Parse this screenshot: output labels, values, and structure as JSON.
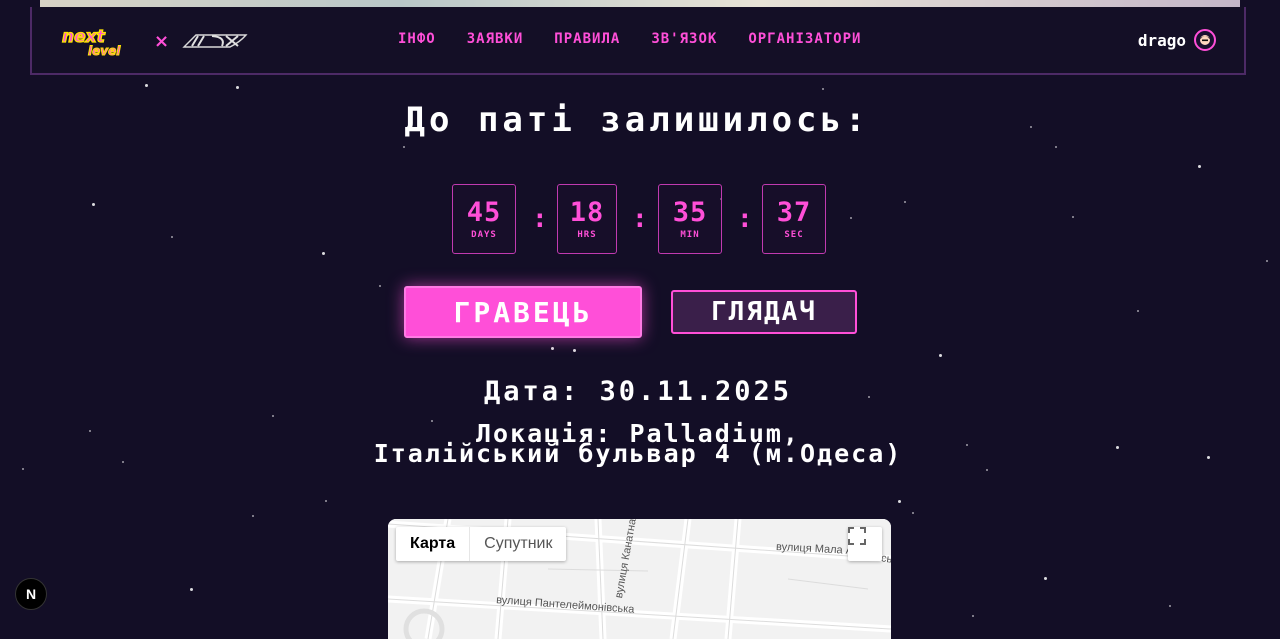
{
  "brand": {
    "logo_text_line1": "next",
    "logo_text_line2": "level",
    "separator": "×",
    "accent_color": "#ff4fd8",
    "background_color": "#130e26"
  },
  "nav": {
    "items": [
      {
        "label": "ІНФО"
      },
      {
        "label": "ЗАЯВКИ"
      },
      {
        "label": "ПРАВИЛА"
      },
      {
        "label": "ЗВ'ЯЗОК"
      },
      {
        "label": "ОРГАНІЗАТОРИ"
      }
    ]
  },
  "user": {
    "name": "drago",
    "avatar_icon": "user-avatar-icon"
  },
  "countdown": {
    "title": "До паті залишилось:",
    "days": {
      "value": "45",
      "unit": "DAYS"
    },
    "hours": {
      "value": "18",
      "unit": "HRS"
    },
    "minutes": {
      "value": "35",
      "unit": "MIN"
    },
    "seconds": {
      "value": "37",
      "unit": "SEC"
    },
    "separator": ":"
  },
  "actions": {
    "player_label": "ГРАВЕЦЬ",
    "viewer_label": "ГЛЯДАЧ"
  },
  "event": {
    "date_line": "Дата: 30.11.2025",
    "location_line1": "Локація: Palladium,",
    "location_line2": "Італійський бульвар 4 (м.Одеса)"
  },
  "map": {
    "tab_map": "Карта",
    "tab_satellite": "Супутник",
    "fullscreen_icon": "fullscreen-icon",
    "street_1": "вулиця Мала А",
    "street_1_tail": "сь",
    "street_2": "вулиця Пантелеймонівська",
    "street_3": "вулиця Канатна"
  },
  "dev_badge": {
    "label": "N"
  }
}
